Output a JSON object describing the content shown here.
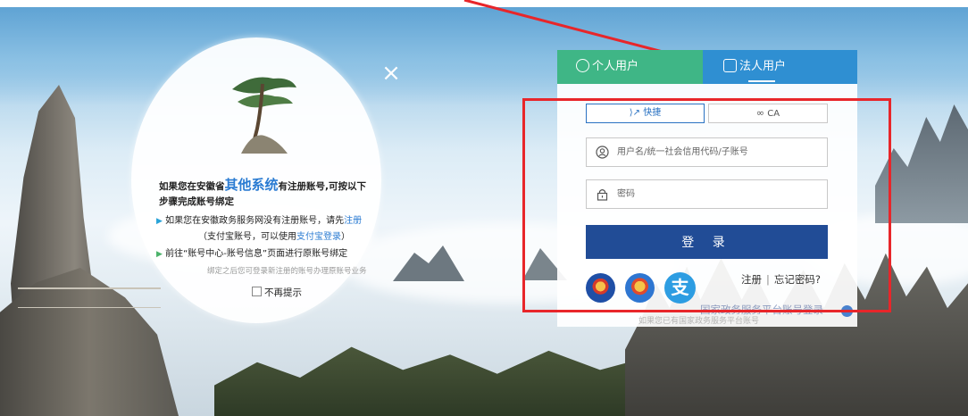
{
  "popup": {
    "line1_a": "如果您在安徽省",
    "line1_highlight": "其他系统",
    "line1_b": "有注册账号,可按以下",
    "line2": "步骤完成账号绑定",
    "bullet1_a": "如果您在安徽政务服务网没有注册账号，请先",
    "bullet1_link": "注册",
    "bullet1_line2_a": "（支付宝账号，可以使用",
    "bullet1_line2_link": "支付宝登录",
    "bullet1_line2_b": "）",
    "bullet2": "前往“账号中心-账号信息”页面进行原账号绑定",
    "note": "绑定之后您可登录新注册的账号办理原账号业务",
    "dont_show": "不再提示",
    "close": "×"
  },
  "tabs": {
    "personal": "个人用户",
    "legal": "法人用户"
  },
  "login": {
    "mode_quick": "快捷",
    "mode_ca": "CA",
    "username_placeholder": "用户名/统一社会信用代码/子账号",
    "password_placeholder": "密码",
    "submit": "登 录",
    "alipay_char": "支",
    "register": "注册",
    "separator": "|",
    "forgot": "忘记密码?"
  },
  "background": {
    "ghost_text": "国家政务服务平台账号登录",
    "ghost_text2": "如果您已有国家政务服务平台账号"
  },
  "colors": {
    "personal_tab": "#3fb686",
    "legal_tab": "#2f8fd2",
    "login_button": "#214c96",
    "highlight_frame": "#e8262a",
    "link": "#2a7bd2"
  }
}
